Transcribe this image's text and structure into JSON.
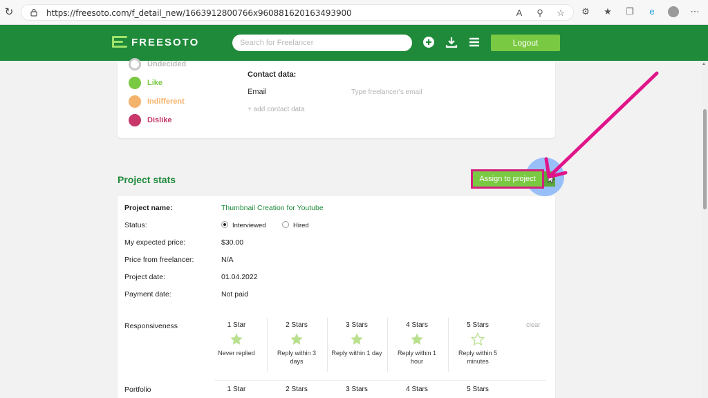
{
  "browser": {
    "url": "https://freesoto.com/f_detail_new/1663912800766x960881620163493900"
  },
  "header": {
    "logo_text": "FREESOTO",
    "search_placeholder": "Search for Freelancer",
    "logout_label": "Logout"
  },
  "ratings": [
    {
      "label": "Undecided",
      "color": "#c8c8c8"
    },
    {
      "label": "Like",
      "color": "#7ac943"
    },
    {
      "label": "Indifferent",
      "color": "#f4b26b"
    },
    {
      "label": "Dislike",
      "color": "#c8376a"
    }
  ],
  "contact": {
    "title": "Contact data:",
    "email_label": "Email",
    "email_placeholder": "Type freelancer's email",
    "add_label": "+ add contact data"
  },
  "project_stats": {
    "title": "Project stats",
    "assign_label": "Assign to project",
    "project_name_label": "Project name:",
    "project_name": "Thumbnail Creation for Youtube",
    "status_label": "Status:",
    "status_options": [
      "Interviewed",
      "Hired"
    ],
    "expected_price_label": "My expected price:",
    "expected_price": "$30.00",
    "freelancer_price_label": "Price from freelancer:",
    "freelancer_price": "N/A",
    "project_date_label": "Project date:",
    "project_date": "01.04.2022",
    "payment_date_label": "Payment date:",
    "payment_date": "Not paid"
  },
  "responsiveness": {
    "label": "Responsiveness",
    "clear_label": "clear",
    "columns": [
      {
        "stars": "1 Star",
        "desc": "Never replied"
      },
      {
        "stars": "2 Stars",
        "desc": "Reply within 3 days"
      },
      {
        "stars": "3 Stars",
        "desc": "Reply within 1 day"
      },
      {
        "stars": "4 Stars",
        "desc": "Reply within 1 hour"
      },
      {
        "stars": "5 Stars",
        "desc": "Reply within 5 minutes"
      }
    ],
    "selected_stars": 4
  },
  "portfolio": {
    "label": "Portfolio",
    "columns": [
      "1 Star",
      "2 Stars",
      "3 Stars",
      "4 Stars",
      "5 Stars"
    ]
  }
}
